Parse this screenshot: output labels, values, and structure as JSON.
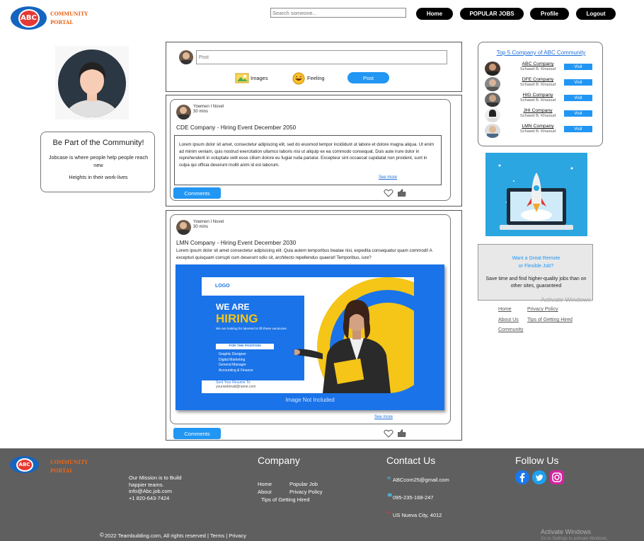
{
  "header": {
    "logo_text": "ABC",
    "brand_line1": "COMMUNITY",
    "brand_line2": "PORTAL",
    "search_placeholder": "Search someone...",
    "nav": [
      "Home",
      "POPULAR JOBS",
      "Profile",
      "Logout"
    ]
  },
  "left": {
    "community_title": "Be Part of the Community!",
    "community_text": "Jobcase is where people help people reach new",
    "community_sub": "Heights in their work-lives"
  },
  "composer": {
    "placeholder": "Post",
    "images_label": "Images",
    "feeling_label": "Feeling",
    "post_label": "Post"
  },
  "posts": [
    {
      "author": "Yowmen I Novel",
      "time": "30 mins",
      "title": "CDE Company - Hiring Event December 2050",
      "body": "Lorem ipsum dolor sit amet, consectetur adipiscing elit, sed do eiusmod tempor incididunt ut labore et dolore magna aliqua. Ut enim ad minim veniam, quis nostrud exercitation ullamco laboris nisi ut aliquip ex ea commodo consequat. Duis aute irure dolor in reprehenderit in voluptate velit esse cillum dolore eu fugiat nulla pariatur. Excepteur sint occaecat cupidatat non proident, sunt in culpa qui officia deserunt mollit anim id est laborum.",
      "see_more": "See more",
      "comments_label": "Comments"
    },
    {
      "author": "Yowmen I Novel",
      "time": "30 mins",
      "title": "LMN Company - Hiring Event December 2030",
      "body": "Lorem ipsum dolor sit amet consectetur adipisicing elit. Quia autem temporibus beatae nisi, expedita consequatur quam commodi! A excepturi quisquam corrupti cum deserunt odio sit, architecto repellendus quaerat! Temporibus, iure?",
      "see_more": "See more",
      "comments_label": "Comments",
      "image": {
        "logo": "LOGO",
        "we_are": "WE ARE",
        "hiring": "HIRING",
        "tagline": "We are looking for talented to fill these vacancies",
        "position_header": "FOR THE POSITION",
        "positions": [
          "Graphic Designer",
          "Digital Marketing",
          "General Manager",
          "Accounting & Finance"
        ],
        "resume_label": "Sent Your Resume To:",
        "resume_email": "yourwebmail@name.com",
        "caption": "Image Not Included"
      }
    }
  ],
  "right": {
    "top_title": "Top 5 Company of ABC Community",
    "companies": [
      {
        "name": "ABC Company",
        "owner": "Schawd B. Khasiud",
        "visit": "Visit"
      },
      {
        "name": "DFE Company",
        "owner": "Schawd B. Khasiud",
        "visit": "Visit"
      },
      {
        "name": "HIG Company",
        "owner": "Schawd B. Khasiud",
        "visit": "Visit"
      },
      {
        "name": "JHI Company",
        "owner": "Schawd B. Khasiud",
        "visit": "Visit"
      },
      {
        "name": "LMN Company",
        "owner": "Schawd B. Khasiud",
        "visit": "Visit"
      }
    ],
    "remote_title_line1": "Want a Great Remote",
    "remote_title_line2": "or Flexible Job?",
    "remote_text": "Save time and find higher-quality jobs than on other sites, guaranteed",
    "links": [
      "Home",
      "Privacy Policy",
      "About Us",
      "Tips of Getting Hired",
      "Community"
    ],
    "watermark": "Activate Windows"
  },
  "footer": {
    "brand_line1": "COMMUNITY",
    "brand_line2": "PORTAL",
    "logo_text": "ABC",
    "mission_line1": "Our Mission is to Build",
    "mission_line2": "happier teams.",
    "email": "info@Abc.job.com",
    "phone": "+1 820-643-7424",
    "company_head": "Company",
    "company_links": [
      "Home",
      "Popular Job",
      "About",
      "Privacy Policy",
      "Tips of Getting Hired"
    ],
    "contact_head": "Contact Us",
    "contact_email": "ABCcom25@gmail.com",
    "contact_phone": "095-235-168-247",
    "contact_address": "US Nueva City, 4012",
    "follow_head": "Follow Us",
    "copyright": "2022 Teambuilding.com, All rights reserved | Terms | Privacy",
    "watermark": "Activate Windows",
    "watermark_sub": "Go to Settings to activate Windows."
  },
  "colors": {
    "accent_blue": "#2196f3",
    "brand_orange": "#e8671a",
    "footer_bg": "#5f5f5f",
    "hiring_yellow": "#f5c518"
  }
}
